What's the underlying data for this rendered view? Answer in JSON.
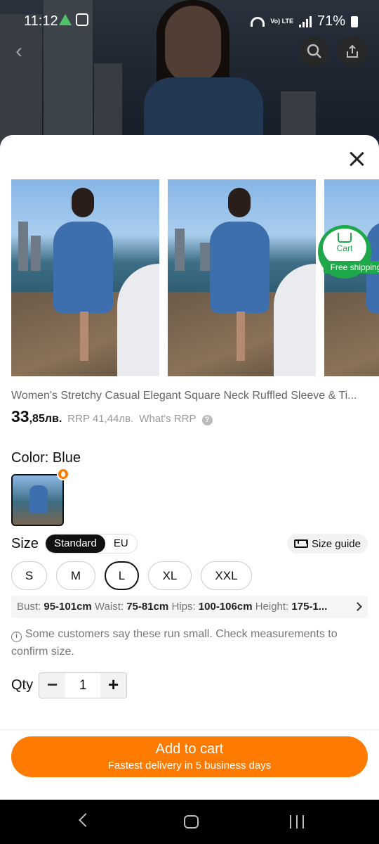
{
  "status_bar": {
    "time": "11:12",
    "volte": "Vo) LTE",
    "battery": "71%"
  },
  "product": {
    "title": "Women's Stretchy Casual Elegant Square Neck Ruffled Sleeve & Ti...",
    "price_int": "33",
    "price_dec": ",85лв.",
    "rrp": "RRP 41,44лв.",
    "rrp_link": "What's RRP",
    "help_glyph": "?"
  },
  "gallery": {
    "badge_cart": "Cart",
    "badge_label": "Free shipping"
  },
  "color": {
    "label": "Color: Blue"
  },
  "size": {
    "label": "Size",
    "standards": [
      "Standard",
      "EU"
    ],
    "active_standard": "Standard",
    "guide_label": "Size guide",
    "options": [
      "S",
      "M",
      "L",
      "XL",
      "XXL"
    ],
    "selected": "L"
  },
  "measurements": {
    "bust_label": "Bust:",
    "bust": "95-101cm",
    "waist_label": "Waist:",
    "waist": "75-81cm",
    "hips_label": "Hips:",
    "hips": "100-106cm",
    "height_label": "Height:",
    "height": "175-1..."
  },
  "fit_note": "Some customers say these run small. Check measurements to confirm size.",
  "quantity": {
    "label": "Qty",
    "value": "1",
    "minus": "−",
    "plus": "+"
  },
  "cta": {
    "label": "Add to cart",
    "sub": "Fastest delivery in 5 business days"
  },
  "colors": {
    "accent": "#ff7a00",
    "shipping_green": "#1fa84a"
  }
}
